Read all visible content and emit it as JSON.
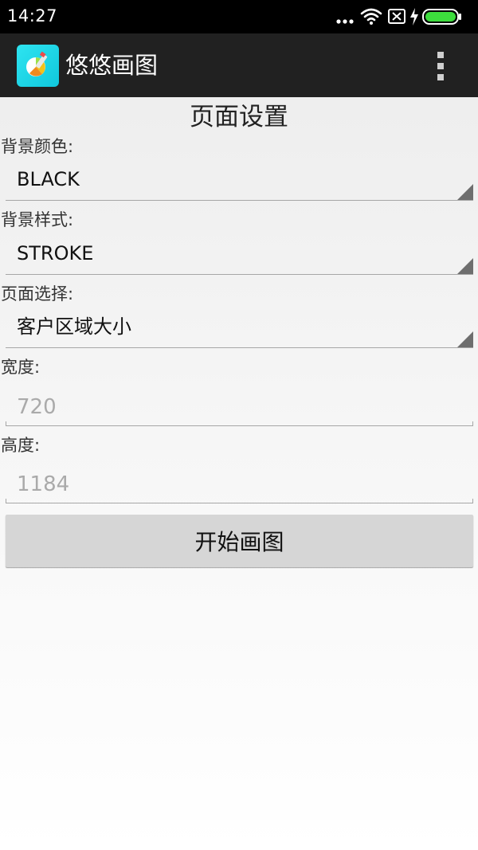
{
  "status_bar": {
    "time": "14:27",
    "battery_color": "#3ddc3d"
  },
  "app_bar": {
    "title": "悠悠画图",
    "icon": "app-logo-icon",
    "menu_icon": "overflow-menu-icon"
  },
  "page": {
    "title": "页面设置"
  },
  "form": {
    "background_color": {
      "label": "背景颜色:",
      "value": "BLACK"
    },
    "background_style": {
      "label": "背景样式:",
      "value": "STROKE"
    },
    "page_select": {
      "label": "页面选择:",
      "value": "客户区域大小"
    },
    "width": {
      "label": "宽度:",
      "value": "720"
    },
    "height": {
      "label": "高度:",
      "value": "1184"
    }
  },
  "actions": {
    "start_label": "开始画图"
  }
}
